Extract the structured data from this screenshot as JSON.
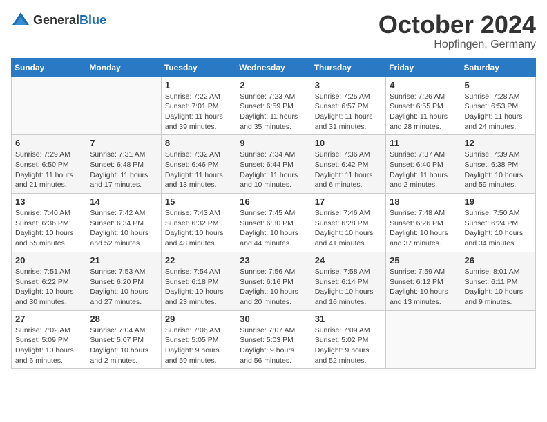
{
  "logo": {
    "text_general": "General",
    "text_blue": "Blue"
  },
  "title": {
    "month": "October 2024",
    "location": "Hopfingen, Germany"
  },
  "weekdays": [
    "Sunday",
    "Monday",
    "Tuesday",
    "Wednesday",
    "Thursday",
    "Friday",
    "Saturday"
  ],
  "weeks": [
    [
      {
        "day": "",
        "info": ""
      },
      {
        "day": "",
        "info": ""
      },
      {
        "day": "1",
        "info": "Sunrise: 7:22 AM\nSunset: 7:01 PM\nDaylight: 11 hours and 39 minutes."
      },
      {
        "day": "2",
        "info": "Sunrise: 7:23 AM\nSunset: 6:59 PM\nDaylight: 11 hours and 35 minutes."
      },
      {
        "day": "3",
        "info": "Sunrise: 7:25 AM\nSunset: 6:57 PM\nDaylight: 11 hours and 31 minutes."
      },
      {
        "day": "4",
        "info": "Sunrise: 7:26 AM\nSunset: 6:55 PM\nDaylight: 11 hours and 28 minutes."
      },
      {
        "day": "5",
        "info": "Sunrise: 7:28 AM\nSunset: 6:53 PM\nDaylight: 11 hours and 24 minutes."
      }
    ],
    [
      {
        "day": "6",
        "info": "Sunrise: 7:29 AM\nSunset: 6:50 PM\nDaylight: 11 hours and 21 minutes."
      },
      {
        "day": "7",
        "info": "Sunrise: 7:31 AM\nSunset: 6:48 PM\nDaylight: 11 hours and 17 minutes."
      },
      {
        "day": "8",
        "info": "Sunrise: 7:32 AM\nSunset: 6:46 PM\nDaylight: 11 hours and 13 minutes."
      },
      {
        "day": "9",
        "info": "Sunrise: 7:34 AM\nSunset: 6:44 PM\nDaylight: 11 hours and 10 minutes."
      },
      {
        "day": "10",
        "info": "Sunrise: 7:36 AM\nSunset: 6:42 PM\nDaylight: 11 hours and 6 minutes."
      },
      {
        "day": "11",
        "info": "Sunrise: 7:37 AM\nSunset: 6:40 PM\nDaylight: 11 hours and 2 minutes."
      },
      {
        "day": "12",
        "info": "Sunrise: 7:39 AM\nSunset: 6:38 PM\nDaylight: 10 hours and 59 minutes."
      }
    ],
    [
      {
        "day": "13",
        "info": "Sunrise: 7:40 AM\nSunset: 6:36 PM\nDaylight: 10 hours and 55 minutes."
      },
      {
        "day": "14",
        "info": "Sunrise: 7:42 AM\nSunset: 6:34 PM\nDaylight: 10 hours and 52 minutes."
      },
      {
        "day": "15",
        "info": "Sunrise: 7:43 AM\nSunset: 6:32 PM\nDaylight: 10 hours and 48 minutes."
      },
      {
        "day": "16",
        "info": "Sunrise: 7:45 AM\nSunset: 6:30 PM\nDaylight: 10 hours and 44 minutes."
      },
      {
        "day": "17",
        "info": "Sunrise: 7:46 AM\nSunset: 6:28 PM\nDaylight: 10 hours and 41 minutes."
      },
      {
        "day": "18",
        "info": "Sunrise: 7:48 AM\nSunset: 6:26 PM\nDaylight: 10 hours and 37 minutes."
      },
      {
        "day": "19",
        "info": "Sunrise: 7:50 AM\nSunset: 6:24 PM\nDaylight: 10 hours and 34 minutes."
      }
    ],
    [
      {
        "day": "20",
        "info": "Sunrise: 7:51 AM\nSunset: 6:22 PM\nDaylight: 10 hours and 30 minutes."
      },
      {
        "day": "21",
        "info": "Sunrise: 7:53 AM\nSunset: 6:20 PM\nDaylight: 10 hours and 27 minutes."
      },
      {
        "day": "22",
        "info": "Sunrise: 7:54 AM\nSunset: 6:18 PM\nDaylight: 10 hours and 23 minutes."
      },
      {
        "day": "23",
        "info": "Sunrise: 7:56 AM\nSunset: 6:16 PM\nDaylight: 10 hours and 20 minutes."
      },
      {
        "day": "24",
        "info": "Sunrise: 7:58 AM\nSunset: 6:14 PM\nDaylight: 10 hours and 16 minutes."
      },
      {
        "day": "25",
        "info": "Sunrise: 7:59 AM\nSunset: 6:12 PM\nDaylight: 10 hours and 13 minutes."
      },
      {
        "day": "26",
        "info": "Sunrise: 8:01 AM\nSunset: 6:11 PM\nDaylight: 10 hours and 9 minutes."
      }
    ],
    [
      {
        "day": "27",
        "info": "Sunrise: 7:02 AM\nSunset: 5:09 PM\nDaylight: 10 hours and 6 minutes."
      },
      {
        "day": "28",
        "info": "Sunrise: 7:04 AM\nSunset: 5:07 PM\nDaylight: 10 hours and 2 minutes."
      },
      {
        "day": "29",
        "info": "Sunrise: 7:06 AM\nSunset: 5:05 PM\nDaylight: 9 hours and 59 minutes."
      },
      {
        "day": "30",
        "info": "Sunrise: 7:07 AM\nSunset: 5:03 PM\nDaylight: 9 hours and 56 minutes."
      },
      {
        "day": "31",
        "info": "Sunrise: 7:09 AM\nSunset: 5:02 PM\nDaylight: 9 hours and 52 minutes."
      },
      {
        "day": "",
        "info": ""
      },
      {
        "day": "",
        "info": ""
      }
    ]
  ]
}
